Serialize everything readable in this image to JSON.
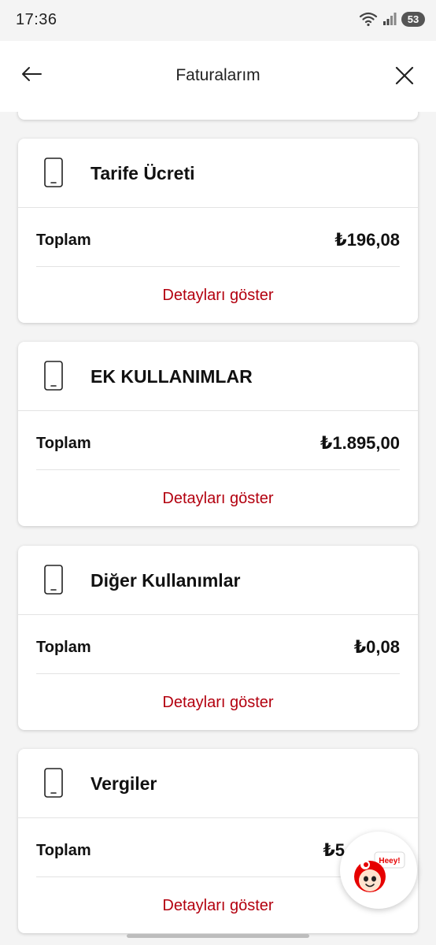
{
  "status_bar": {
    "time": "17:36",
    "battery": "53",
    "icons": [
      "wifi-icon",
      "signal-icon",
      "battery-icon"
    ]
  },
  "header": {
    "title": "Faturalarım",
    "back_icon": "arrow-left-icon",
    "close_icon": "close-icon"
  },
  "cards": [
    {
      "title": "Tarife Ücreti",
      "icon": "phone-icon",
      "total_label": "Toplam",
      "total_value": "₺196,08",
      "link": "Detayları göster"
    },
    {
      "title": "EK KULLANIMLAR",
      "icon": "phone-icon",
      "total_label": "Toplam",
      "total_value": "₺1.895,00",
      "link": "Detayları göster"
    },
    {
      "title": "Diğer Kullanımlar",
      "icon": "phone-icon",
      "total_label": "Toplam",
      "total_value": "₺0,08",
      "link": "Detayları göster"
    },
    {
      "title": "Vergiler",
      "icon": "phone-icon",
      "total_label": "Toplam",
      "total_value": "₺5",
      "link": "Detayları göster"
    }
  ],
  "chat": {
    "bubble_text": "Heey!",
    "icon": "chatbot-mascot-icon"
  },
  "colors": {
    "accent": "#b3000f",
    "brand_red": "#e60000",
    "background": "#f4f4f4",
    "card": "#ffffff"
  }
}
